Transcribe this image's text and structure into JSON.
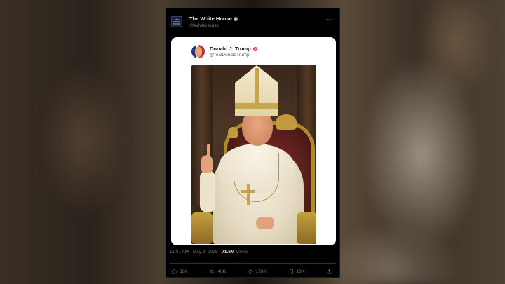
{
  "post": {
    "author_name": "The White House",
    "author_handle": "@WhiteHouse",
    "author_avatar_text": "THE WHITE HOUSE",
    "verified_color": "#829aab",
    "more_label": "···"
  },
  "quoted": {
    "name": "Donald J. Trump",
    "handle": "@realDonaldTrump",
    "verified_color": "#f91880",
    "image_alt": "AI-generated image of Trump dressed as the pope seated on a throne"
  },
  "meta": {
    "time": "11:07 AM · May 3, 2025 · ",
    "views_count": "71.6M",
    "views_label": " Views"
  },
  "actions": {
    "replies": "38K",
    "reposts": "48K",
    "likes": "178K",
    "bookmarks": "19K"
  },
  "icons": {
    "reply": "reply-icon",
    "repost": "repost-icon",
    "like": "heart-icon",
    "bookmark": "bookmark-icon",
    "share": "share-icon"
  }
}
